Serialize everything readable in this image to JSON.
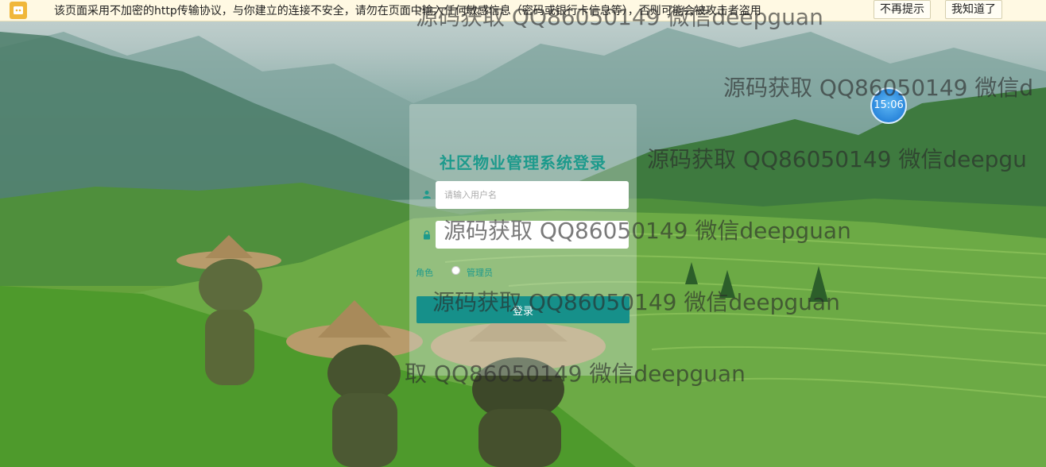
{
  "security_bar": {
    "message": "该页面采用不加密的http传输协议，与你建立的连接不安全，请勿在页面中输入任何敏感信息（密码或银行卡信息等），否则可能会被攻击者盗用",
    "dont_remind_label": "不再提示",
    "got_it_label": "我知道了"
  },
  "login": {
    "title": "社区物业管理系统登录",
    "username_placeholder": "请输入用户名",
    "password_value": "",
    "role_label": "角色",
    "role_option": "管理员",
    "submit_label": "登录"
  },
  "clock": {
    "time": "15:06"
  },
  "watermarks": [
    "源码获取 QQ86050149 微信deepguan",
    "源码获取 QQ86050149 微信d",
    "源码获取 QQ86050149 微信deepgu",
    "源码获取 QQ86050149 微信deepguan",
    "源码获取 QQ86050149 微信deepguan",
    "取 QQ86050149 微信deepguan"
  ],
  "colors": {
    "accent": "#1d9a8c",
    "button": "#16908a",
    "security_bar": "#fff9e3"
  }
}
